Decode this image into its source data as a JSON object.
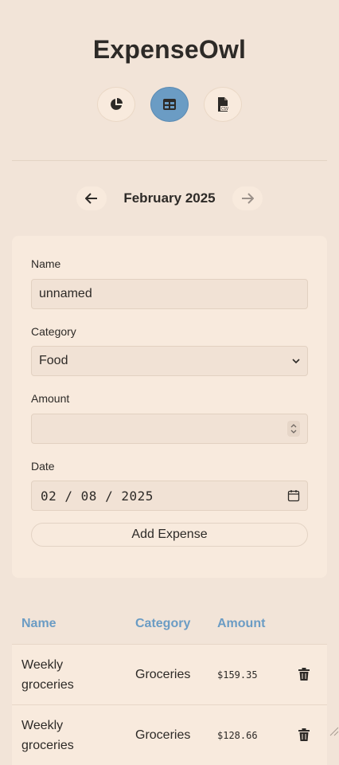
{
  "app": {
    "title": "ExpenseOwl"
  },
  "nav": {
    "items": [
      {
        "name": "dashboard",
        "icon": "pie-chart-icon",
        "active": false
      },
      {
        "name": "table",
        "icon": "table-icon",
        "active": true
      },
      {
        "name": "export-csv",
        "icon": "csv-file-icon",
        "active": false
      }
    ]
  },
  "month_nav": {
    "label": "February 2025",
    "prev_icon": "arrow-left-icon",
    "next_icon": "arrow-right-icon"
  },
  "form": {
    "name_label": "Name",
    "name_value": "unnamed",
    "category_label": "Category",
    "category_value": "Food",
    "amount_label": "Amount",
    "amount_value": "",
    "date_label": "Date",
    "date_value": "02 / 08 / 2025",
    "submit_label": "Add Expense"
  },
  "table": {
    "headers": {
      "name": "Name",
      "category": "Category",
      "amount": "Amount"
    },
    "rows": [
      {
        "name": "Weekly groceries",
        "category": "Groceries",
        "amount": "$159.35"
      },
      {
        "name": "Weekly groceries",
        "category": "Groceries",
        "amount": "$128.66"
      }
    ]
  },
  "colors": {
    "accent": "#6b9cc4",
    "background": "#f2e4d8",
    "card": "#f8eadd"
  }
}
